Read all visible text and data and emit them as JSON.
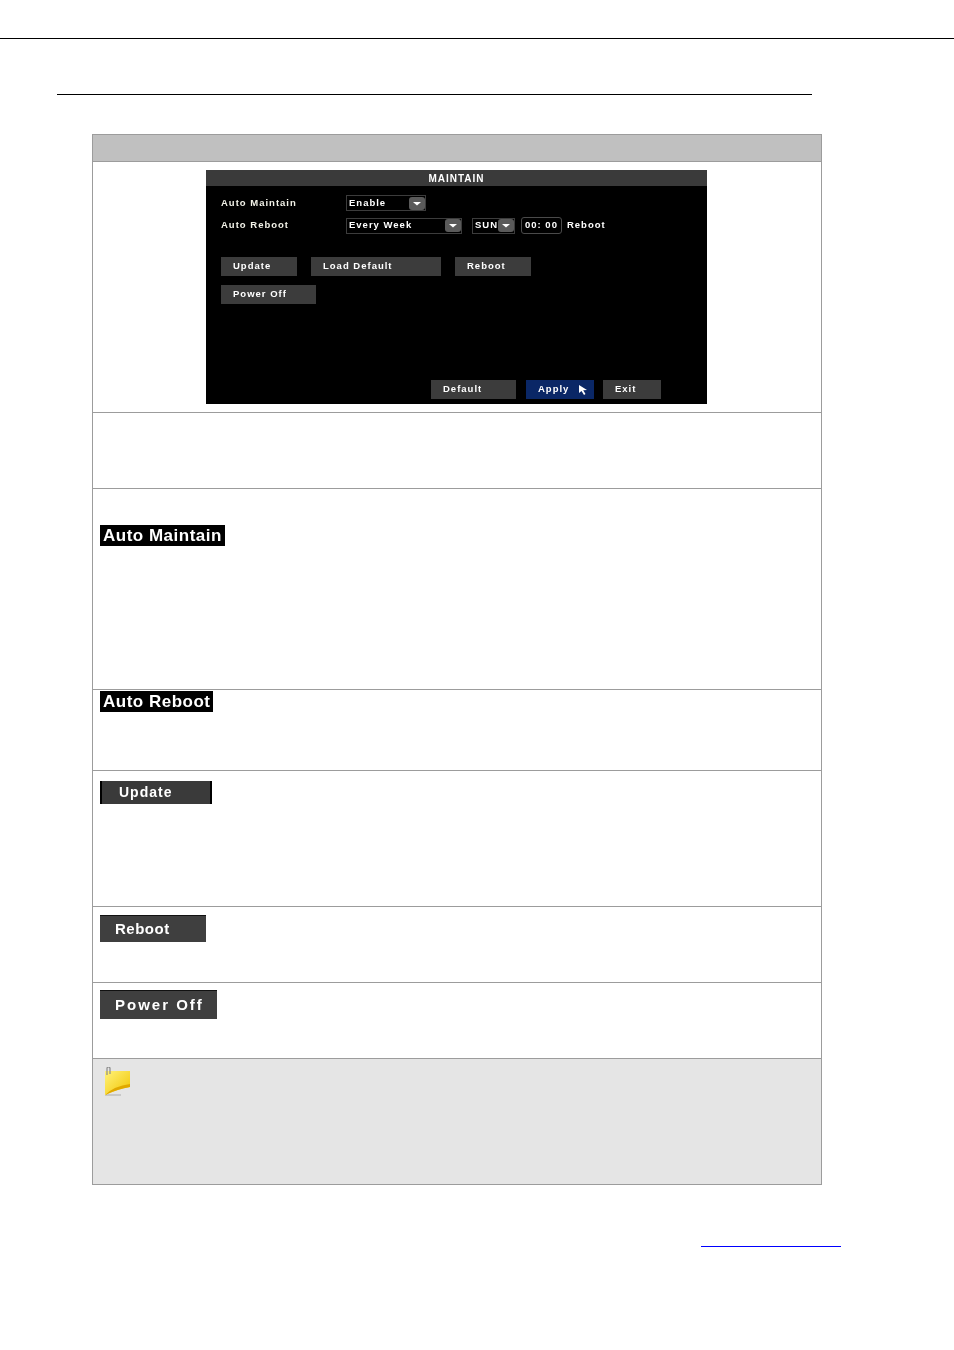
{
  "dialog": {
    "title": "MAINTAIN",
    "settings": [
      {
        "label": "Auto Maintain",
        "controls": [
          {
            "kind": "dropdown",
            "value": "Enable"
          }
        ]
      },
      {
        "label": "Auto Reboot",
        "controls": [
          {
            "kind": "dropdown",
            "value": "Every Week"
          },
          {
            "kind": "dropdown",
            "value": "SUN"
          },
          {
            "kind": "time",
            "value": "00: 00"
          },
          {
            "kind": "label",
            "value": "Reboot"
          }
        ]
      }
    ],
    "action_rows": [
      {
        "buttons": [
          "Update",
          "Load Default",
          "Reboot"
        ]
      },
      {
        "buttons": [
          "Power Off"
        ]
      }
    ],
    "footer_buttons": [
      {
        "label": "Default",
        "selected": false
      },
      {
        "label": "Apply",
        "selected": true
      },
      {
        "label": "Exit",
        "selected": false
      }
    ]
  },
  "table": {
    "rows": [
      {
        "kind": "screenshot"
      },
      {
        "kind": "blank"
      },
      {
        "kind": "label_chip",
        "text": "Auto Maintain"
      },
      {
        "kind": "label_chip",
        "text": "Auto Reboot"
      },
      {
        "kind": "button_chip",
        "text": "Update"
      },
      {
        "kind": "button_chip",
        "text": "Reboot"
      },
      {
        "kind": "button_chip",
        "text": "Power Off"
      },
      {
        "kind": "note"
      }
    ]
  }
}
